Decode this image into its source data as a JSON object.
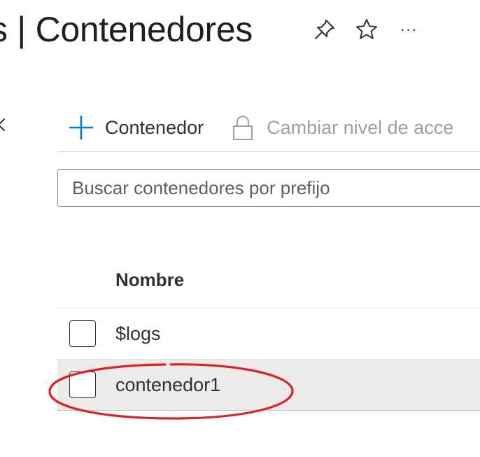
{
  "header": {
    "title": "s | Contenedores",
    "pin_icon": "pin-icon",
    "favorite_icon": "star-icon",
    "more_label": "···"
  },
  "sidebar": {
    "collapse_icon": "chevron-left-icon"
  },
  "toolbar": {
    "add_container_label": "Contenedor",
    "add_icon": "plus-icon",
    "change_access_label": "Cambiar nivel de acce",
    "lock_icon": "lock-icon"
  },
  "search": {
    "placeholder": "Buscar contenedores por prefijo",
    "value": ""
  },
  "table": {
    "columns": [
      "Nombre"
    ],
    "rows": [
      {
        "name": "$logs",
        "checked": false,
        "selected": false
      },
      {
        "name": "contenedor1",
        "checked": false,
        "selected": true
      }
    ]
  },
  "colors": {
    "accent": "#0078d4",
    "annotation": "#d9222a",
    "selected_row": "#edebe9"
  }
}
